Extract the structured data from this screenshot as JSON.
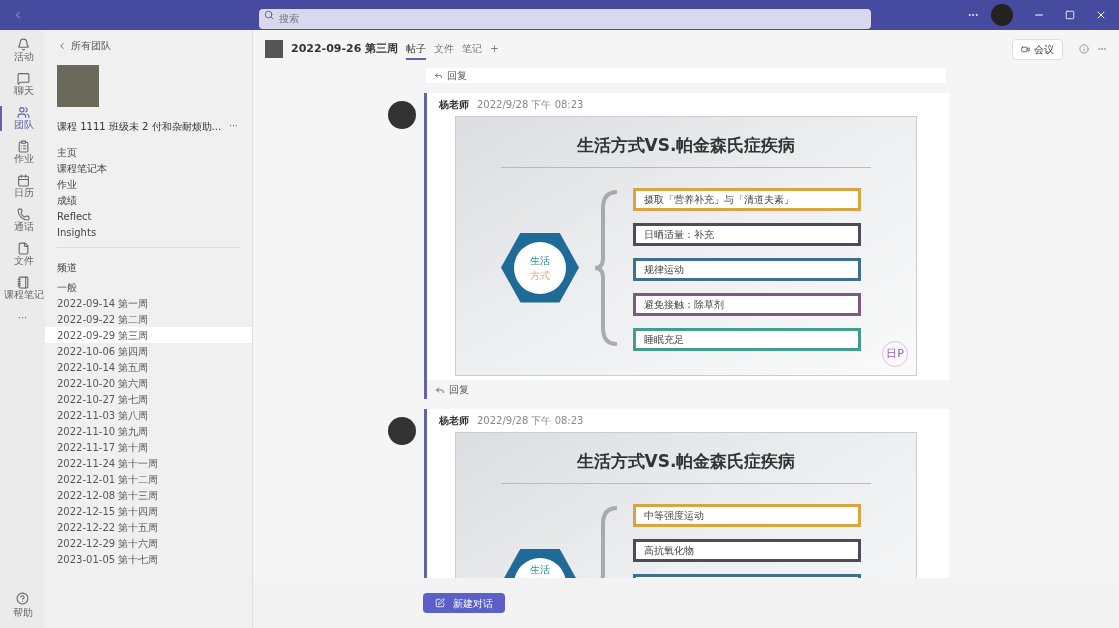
{
  "title_bar": {
    "search": {
      "placeholder": "搜索"
    }
  },
  "rail": [
    {
      "label": "活动",
      "selected": false
    },
    {
      "label": "聊天",
      "selected": false
    },
    {
      "label": "团队",
      "selected": true
    },
    {
      "label": "作业",
      "selected": false
    },
    {
      "label": "日历",
      "selected": false
    },
    {
      "label": "通话",
      "selected": false
    },
    {
      "label": "文件",
      "selected": false
    },
    {
      "label": "课程笔记",
      "selected": false
    }
  ],
  "rail_more": "···",
  "rail_help": "帮助",
  "sidebar": {
    "back": "所有团队",
    "team_name": "课程 1111 班级未 2 付和杂耐烦助...",
    "team_more": "···",
    "menu": [
      {
        "label": "主页"
      },
      {
        "label": "课程笔记本"
      },
      {
        "label": "作业"
      },
      {
        "label": "成绩"
      },
      {
        "label": "Reflect"
      },
      {
        "label": "Insights"
      }
    ],
    "channels_heading": "频道",
    "channels": [
      {
        "label": "一般",
        "selected": false
      },
      {
        "label": "2022-09-14 第一周",
        "selected": false
      },
      {
        "label": "2022-09-22 第二周",
        "selected": false
      },
      {
        "label": "2022-09-29 第三周",
        "selected": true
      },
      {
        "label": "2022-10-06 第四周",
        "selected": false
      },
      {
        "label": "2022-10-14 第五周",
        "selected": false
      },
      {
        "label": "2022-10-20 第六周",
        "selected": false
      },
      {
        "label": "2022-10-27 第七周",
        "selected": false
      },
      {
        "label": "2022-11-03 第八周",
        "selected": false
      },
      {
        "label": "2022-11-10 第九周",
        "selected": false
      },
      {
        "label": "2022-11-17 第十周",
        "selected": false
      },
      {
        "label": "2022-11-24 第十一周",
        "selected": false
      },
      {
        "label": "2022-12-01 第十二周",
        "selected": false
      },
      {
        "label": "2022-12-08 第十三周",
        "selected": false
      },
      {
        "label": "2022-12-15 第十四周",
        "selected": false
      },
      {
        "label": "2022-12-22 第十五周",
        "selected": false
      },
      {
        "label": "2022-12-29 第十六周",
        "selected": false
      },
      {
        "label": "2023-01-05 第十七周",
        "selected": false
      }
    ]
  },
  "channel_header": {
    "title": "2022-09-26 第三周",
    "tabs": [
      {
        "label": "帖子",
        "selected": true
      },
      {
        "label": "文件",
        "selected": false
      },
      {
        "label": "笔记",
        "selected": false
      },
      {
        "label": "+",
        "selected": false
      }
    ],
    "meet": "会议"
  },
  "top_reply": "回复",
  "posts": [
    {
      "author": "杨老师",
      "time": "2022/9/28 下午 08:23",
      "slide": {
        "title": "生活方式VS.帕金森氏症疾病",
        "hub_top": "生活",
        "hub_bottom": "方式",
        "badge": "日P",
        "items": [
          {
            "text": "摄取「营养补充」与「清道夫素」",
            "color": "#d9a441"
          },
          {
            "text": "日晒适量：补充",
            "color": "#4b4b5a"
          },
          {
            "text": "规律运动",
            "color": "#3f6f8f"
          },
          {
            "text": "避免接触：除草剂",
            "color": "#7a5a80"
          },
          {
            "text": "睡眠充足",
            "color": "#3f9f8a"
          }
        ]
      },
      "reply": "回复"
    },
    {
      "author": "杨老师",
      "time": "2022/9/28 下午 08:23",
      "slide": {
        "title": "生活方式VS.帕金森氏症疾病",
        "hub_top": "生活",
        "items": [
          {
            "text": "中等强度运动",
            "color": "#d9a441"
          },
          {
            "text": "高抗氧化物",
            "color": "#4b4b5a"
          },
          {
            "color": "#3f6f8f"
          }
        ]
      }
    }
  ],
  "new_conversation": "新建对话"
}
